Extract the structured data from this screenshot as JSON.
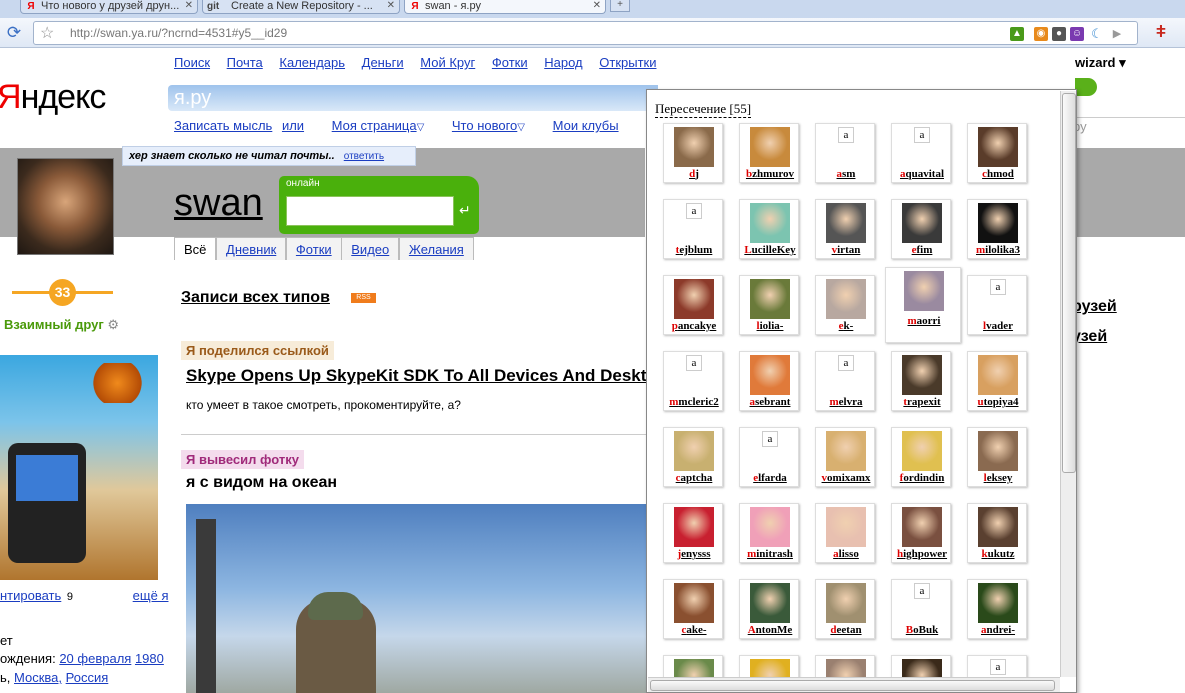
{
  "browser": {
    "tabs": [
      {
        "title": "Что нового у друзей друн...",
        "icon": "yandex-icon"
      },
      {
        "title": "Create a New Repository - ...",
        "icon": "git-icon"
      },
      {
        "title": "swan - я.ру",
        "icon": "yandex-icon"
      }
    ],
    "url": "http://swan.ya.ru/?ncrnd=4531#y5__id29"
  },
  "logo": {
    "ya": "Я",
    "rest": "ндекс"
  },
  "topnav": [
    "Поиск",
    "Почта",
    "Календарь",
    "Деньги",
    "Мой Круг",
    "Фотки",
    "Народ",
    "Открытки"
  ],
  "yaru": "я.ру",
  "subnav": {
    "write": "Записать мысль",
    "or": "или",
    "mypage": "Моя страница",
    "whatsnew": "Что нового",
    "clubs": "Мои клубы"
  },
  "status": {
    "text": "хер знает сколько не читал почты..",
    "reply": "ответить"
  },
  "profile": {
    "username": "swan",
    "online_label": "онлайн",
    "tabs": [
      "Всё",
      "Дневник",
      "Фотки",
      "Видео",
      "Желания"
    ],
    "karma": "33",
    "mutual": "Взаимный друг"
  },
  "feed": {
    "title": "Записи всех типов",
    "rss": "RSS",
    "post1": {
      "tag": "Я поделился ссылкой",
      "title": "Skype Opens Up SkypeKit SDK To All Devices And Deskt",
      "text": "кто умеет в такое смотреть, прокоментируйте, а?"
    },
    "post2": {
      "tag": "Я вывесил фотку",
      "title": "я с видом на океан"
    }
  },
  "sidebar": {
    "comment_link": "нтировать",
    "comment_count": "9",
    "more_link": "ещё я",
    "line1": "ет",
    "birth_label": "ождения:",
    "birth_date": "20 февраля",
    "birth_year": "1980",
    "loc_comma": "ь,",
    "loc_city": "Москва,",
    "loc_country": "Россия"
  },
  "right_fragment": {
    "user": "wizard",
    "friends1": "рузей",
    "friends2": "узей",
    "search_hint": "ру"
  },
  "popup": {
    "title": "Пересечение [55]",
    "friends": [
      {
        "name": "dj",
        "pic": "photo",
        "color": "#8a6a4a"
      },
      {
        "name": "bzhmurov",
        "pic": "photo",
        "color": "#c88a3c"
      },
      {
        "name": "asm",
        "pic": "blank"
      },
      {
        "name": "aquavital",
        "pic": "blank"
      },
      {
        "name": "chmod",
        "pic": "photo",
        "color": "#5a3c2a"
      },
      {
        "name": "tejblum",
        "pic": "blank"
      },
      {
        "name": "LucilleKey",
        "pic": "photo",
        "color": "#7cc4b0"
      },
      {
        "name": "virtan",
        "pic": "photo",
        "color": "#555555"
      },
      {
        "name": "efim",
        "pic": "photo",
        "color": "#3a3a3a"
      },
      {
        "name": "milolika3",
        "pic": "photo",
        "color": "#111111"
      },
      {
        "name": "pancakye",
        "pic": "photo",
        "color": "#8c3a2a"
      },
      {
        "name": "liolia-",
        "pic": "photo",
        "color": "#6a7a3a"
      },
      {
        "name": "ek-",
        "pic": "photo",
        "color": "#b8a8a0"
      },
      {
        "name": "maorri",
        "pic": "photo",
        "color": "#9a8aa0"
      },
      {
        "name": "lvader",
        "pic": "blank"
      },
      {
        "name": "mmcleric2",
        "pic": "blank"
      },
      {
        "name": "asebrant",
        "pic": "photo",
        "color": "#e07a3a"
      },
      {
        "name": "melvra",
        "pic": "blank"
      },
      {
        "name": "trapexit",
        "pic": "photo",
        "color": "#4a3a2a"
      },
      {
        "name": "utopiya4",
        "pic": "photo",
        "color": "#d8a060"
      },
      {
        "name": "captcha",
        "pic": "photo",
        "color": "#c8b070"
      },
      {
        "name": "elfarda",
        "pic": "blank"
      },
      {
        "name": "vomixamx",
        "pic": "photo",
        "color": "#d8b070"
      },
      {
        "name": "fordindin",
        "pic": "photo",
        "color": "#e0c050"
      },
      {
        "name": "leksey",
        "pic": "photo",
        "color": "#8a6a50"
      },
      {
        "name": "jenysss",
        "pic": "photo",
        "color": "#c82030"
      },
      {
        "name": "minitrash",
        "pic": "photo",
        "color": "#f0a0b8"
      },
      {
        "name": "alisso",
        "pic": "photo",
        "color": "#e8c0b0"
      },
      {
        "name": "highpower",
        "pic": "photo",
        "color": "#7a5040"
      },
      {
        "name": "kukutz",
        "pic": "photo",
        "color": "#5a4030"
      },
      {
        "name": "cake-",
        "pic": "photo",
        "color": "#8a5030"
      },
      {
        "name": "AntonMe",
        "pic": "photo",
        "color": "#3a5a3a"
      },
      {
        "name": "deetan",
        "pic": "photo",
        "color": "#a09070"
      },
      {
        "name": "BoBuk",
        "pic": "blank"
      },
      {
        "name": "andrei-",
        "pic": "photo",
        "color": "#2a4a1a"
      },
      {
        "name": "",
        "pic": "photo",
        "color": "#6a8a4a"
      },
      {
        "name": "",
        "pic": "photo",
        "color": "#e0b020"
      },
      {
        "name": "",
        "pic": "photo",
        "color": "#9a8070"
      },
      {
        "name": "",
        "pic": "photo",
        "color": "#3a2a1a"
      },
      {
        "name": "",
        "pic": "blank"
      }
    ]
  }
}
